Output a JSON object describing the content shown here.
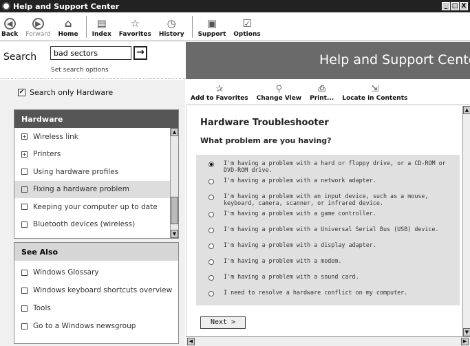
{
  "window": {
    "title": "Help and Support Center",
    "controls": [
      "_",
      "□",
      "X"
    ]
  },
  "toolbar": {
    "back": "Back",
    "forward": "Forward",
    "home": "Home",
    "index": "Index",
    "favorites": "Favorites",
    "history": "History",
    "support": "Support",
    "options": "Options"
  },
  "search": {
    "label": "Search",
    "value": "bad sectors",
    "go_glyph": "→",
    "set_options": "Set search options"
  },
  "banner": {
    "title": "Help and Support Center"
  },
  "filter": {
    "label": "Search only Hardware",
    "checked": true
  },
  "hardware": {
    "heading": "Hardware",
    "items": [
      "Wireless link",
      "Printers",
      "Using hardware profiles",
      "Fixing a hardware problem",
      "Keeping your computer up to date",
      "Bluetooth devices (wireless)"
    ],
    "selected": "Fixing a hardware problem"
  },
  "see_also": {
    "heading": "See Also",
    "items": [
      "Windows Glossary",
      "Windows keyboard shortcuts overview",
      "Tools",
      "Go to a Windows newsgroup"
    ]
  },
  "content_toolbar": {
    "add_favorites": "Add to Favorites",
    "change_view": "Change View",
    "print": "Print...",
    "locate": "Locate in Contents"
  },
  "troubleshooter": {
    "title": "Hardware Troubleshooter",
    "question": "What problem are you having?",
    "options": [
      "I'm having a problem with a hard or floppy drive, or a CD-ROM or DVD-ROM drive.",
      "I'm having a problem with a network adapter.",
      "I'm having a problem with an input device, such as a mouse, keyboard, camera, scanner, or infrared device.",
      "I'm having a problem with a game controller.",
      "I'm having a problem with a Universal Serial Bus (USB) device.",
      "I'm having a problem with a display adapter.",
      "I'm having a problem with a modem.",
      "I'm having a problem with a sound card.",
      "I need to resolve a hardware conflict on my computer."
    ],
    "selected_index": 0,
    "next_label": "Next >"
  }
}
